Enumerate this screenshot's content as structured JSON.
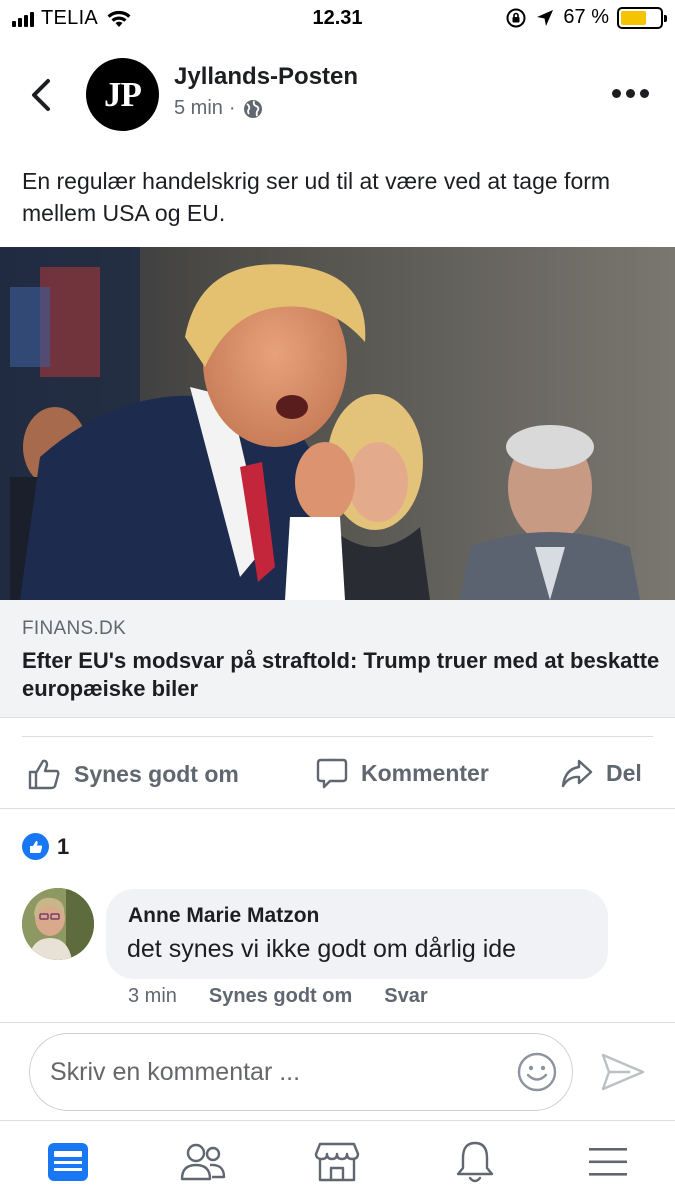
{
  "status_bar": {
    "carrier": "TELIA",
    "time": "12.31",
    "battery_percent": "67 %",
    "battery_level": 0.67
  },
  "post": {
    "page_name": "Jyllands-Posten",
    "avatar_text": "JP",
    "time_ago": "5 min",
    "separator": "·",
    "text": "En regulær handelskrig ser ud til at være ved at tage form mellem USA og EU.",
    "link": {
      "domain": "FINANS.DK",
      "title": "Efter EU's modsvar på straftold: Trump truer med at beskatte europæiske biler"
    }
  },
  "actions": {
    "like_label": "Synes godt om",
    "comment_label": "Kommenter",
    "share_label": "Del"
  },
  "reactions": {
    "count": "1"
  },
  "comment": {
    "author": "Anne Marie Matzon",
    "text": "det synes vi ikke godt om dårlig ide",
    "time": "3 min",
    "like_label": "Synes godt om",
    "reply_label": "Svar"
  },
  "composer": {
    "placeholder": "Skriv en kommentar ..."
  },
  "colors": {
    "accent": "#1877f2",
    "secondary_text": "#606770",
    "battery": "#f4c400"
  },
  "tabbar": [
    "news-feed-icon",
    "friends-icon",
    "marketplace-icon",
    "notifications-icon",
    "menu-icon"
  ]
}
